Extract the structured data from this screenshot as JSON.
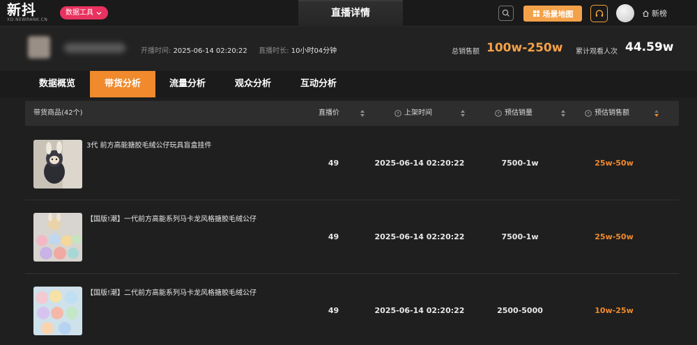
{
  "header": {
    "logo": "新抖",
    "logo_sub": "XD.NEWRANK.CN",
    "tool_label": "数据工具",
    "page_title": "直播详情",
    "map_label": "场景地图",
    "newlist_label": "新榜"
  },
  "live_info": {
    "start_label": "开播时间:",
    "start_value": "2025-06-14 02:20:22",
    "duration_label": "直播时长:",
    "duration_value": "10小时04分钟",
    "total_sales_label": "总销售额",
    "total_sales_value": "100w-250w",
    "views_label": "累计观看人次",
    "views_value": "44.59w"
  },
  "tabs": [
    {
      "label": "数据概览",
      "active": false
    },
    {
      "label": "带货分析",
      "active": true
    },
    {
      "label": "流量分析",
      "active": false
    },
    {
      "label": "观众分析",
      "active": false
    },
    {
      "label": "互动分析",
      "active": false
    }
  ],
  "table": {
    "columns": {
      "product": "带货商品(42个)",
      "price": "直播价",
      "listed_time": "上架时间",
      "est_sales": "预估销量",
      "est_revenue": "预估销售额"
    },
    "rows": [
      {
        "name": "3代 前方高能搪胶毛绒公仔玩具盲盒挂件",
        "price": "49",
        "time": "2025-06-14 02:20:22",
        "sales": "7500-1w",
        "revenue": "25w-50w"
      },
      {
        "name": "【国版!潮】一代前方高能系列马卡龙风格搪胶毛绒公仔",
        "price": "49",
        "time": "2025-06-14 02:20:22",
        "sales": "7500-1w",
        "revenue": "25w-50w"
      },
      {
        "name": "【国版!潮】二代前方高能系列马卡龙风格搪胶毛绒公仔",
        "price": "49",
        "time": "2025-06-14 02:20:22",
        "sales": "2500-5000",
        "revenue": "10w-25w"
      }
    ]
  },
  "colors": {
    "accent": "#f08a2c",
    "tool_pill": "#e8325f",
    "map_button": "#f4a24a",
    "background": "#1f1f1f"
  },
  "icons": [
    "search-icon",
    "map-icon",
    "headset-icon",
    "home-icon",
    "chevron-down-icon",
    "sort-icon",
    "question-icon"
  ]
}
